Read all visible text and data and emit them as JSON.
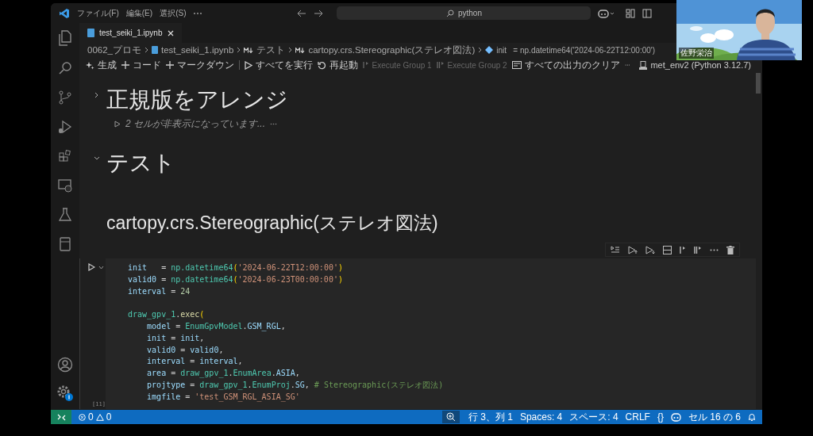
{
  "title_bar": {
    "menu": [
      "ファイル(F)",
      "編集(E)",
      "選択(S)"
    ],
    "search": {
      "value": "python"
    }
  },
  "tabs": [
    {
      "label": "test_seiki_1.ipynb",
      "selected": true
    }
  ],
  "breadcrumb": [
    {
      "label": "0062_プロモ",
      "kind": "folder"
    },
    {
      "label": "test_seiki_1.ipynb",
      "kind": "notebook"
    },
    {
      "label": "テスト",
      "kind": "markdown"
    },
    {
      "label": "cartopy.crs.Stereographic(ステレオ図法)",
      "kind": "markdown"
    },
    {
      "label": "init   = np.datetime64('2024-06-22T12:00:00')",
      "kind": "variable"
    }
  ],
  "toolbar": [
    {
      "label": "生成",
      "kind": "sparkle",
      "disabled": false
    },
    {
      "label": "コード",
      "kind": "plus",
      "disabled": false
    },
    {
      "label": "マークダウン",
      "kind": "plus",
      "disabled": false
    },
    {
      "label": "すべてを実行",
      "kind": "run",
      "disabled": false
    },
    {
      "label": "再起動",
      "kind": "restart",
      "disabled": false
    },
    {
      "label": "Execute Group 1",
      "kind": "group1",
      "disabled": true
    },
    {
      "label": "Execute Group 2",
      "kind": "group2",
      "disabled": true
    },
    {
      "label": "すべての出力のクリア",
      "kind": "clear",
      "disabled": false
    }
  ],
  "kernel": "met_env2 (Python 3.12.7)",
  "cells": [
    {
      "kind": "h1",
      "text": "正規版をアレンジ",
      "expanded": false,
      "hidden_note": "2 セルが非表示になっています..."
    },
    {
      "kind": "h1",
      "text": "テスト",
      "expanded": true
    },
    {
      "kind": "h2",
      "text": "cartopy.crs.Stereographic(ステレオ図法)"
    },
    {
      "kind": "code",
      "execution_count": "[11]",
      "lines": [
        {
          "kind": "code",
          "t": [
            {
              "text": "init",
              "kind": "var"
            },
            {
              "text": "   = ",
              "kind": "op"
            },
            {
              "text": "np.datetime64",
              "kind": "cls"
            },
            {
              "text": "(",
              "kind": "paren"
            },
            {
              "text": "'2024-06-22T12:00:00'",
              "kind": "str"
            },
            {
              "text": ")",
              "kind": "paren"
            }
          ]
        },
        {
          "kind": "code",
          "t": [
            {
              "text": "valid0",
              "kind": "var"
            },
            {
              "text": " = ",
              "kind": "op"
            },
            {
              "text": "np.datetime64",
              "kind": "cls"
            },
            {
              "text": "(",
              "kind": "paren"
            },
            {
              "text": "'2024-06-23T00:00:00'",
              "kind": "str"
            },
            {
              "text": ")",
              "kind": "paren"
            }
          ]
        },
        {
          "kind": "code",
          "t": [
            {
              "text": "interval",
              "kind": "var"
            },
            {
              "text": " = ",
              "kind": "op"
            },
            {
              "text": "24",
              "kind": "num"
            }
          ]
        },
        {
          "kind": "blank"
        },
        {
          "kind": "code",
          "t": [
            {
              "text": "draw_gpv_1",
              "kind": "cls"
            },
            {
              "text": ".",
              "kind": "op"
            },
            {
              "text": "exec",
              "kind": "fn"
            },
            {
              "text": "(",
              "kind": "paren"
            }
          ]
        },
        {
          "kind": "code",
          "t": [
            {
              "text": "    model",
              "kind": "var"
            },
            {
              "text": " = ",
              "kind": "op"
            },
            {
              "text": "EnumGpvModel",
              "kind": "cls"
            },
            {
              "text": ".",
              "kind": "op"
            },
            {
              "text": "GSM_RGL",
              "kind": "var"
            },
            {
              "text": ",",
              "kind": "op"
            }
          ]
        },
        {
          "kind": "code",
          "t": [
            {
              "text": "    init",
              "kind": "var"
            },
            {
              "text": " = ",
              "kind": "op"
            },
            {
              "text": "init",
              "kind": "var"
            },
            {
              "text": ",",
              "kind": "op"
            }
          ]
        },
        {
          "kind": "code",
          "t": [
            {
              "text": "    valid0",
              "kind": "var"
            },
            {
              "text": " = ",
              "kind": "op"
            },
            {
              "text": "valid0",
              "kind": "var"
            },
            {
              "text": ",",
              "kind": "op"
            }
          ]
        },
        {
          "kind": "code",
          "t": [
            {
              "text": "    interval",
              "kind": "var"
            },
            {
              "text": " = ",
              "kind": "op"
            },
            {
              "text": "interval",
              "kind": "var"
            },
            {
              "text": ",",
              "kind": "op"
            }
          ]
        },
        {
          "kind": "code",
          "t": [
            {
              "text": "    area",
              "kind": "var"
            },
            {
              "text": " = ",
              "kind": "op"
            },
            {
              "text": "draw_gpv_1",
              "kind": "cls"
            },
            {
              "text": ".",
              "kind": "op"
            },
            {
              "text": "EnumArea",
              "kind": "cls"
            },
            {
              "text": ".",
              "kind": "op"
            },
            {
              "text": "ASIA",
              "kind": "var"
            },
            {
              "text": ",",
              "kind": "op"
            }
          ]
        },
        {
          "kind": "code",
          "t": [
            {
              "text": "    projtype",
              "kind": "var"
            },
            {
              "text": " = ",
              "kind": "op"
            },
            {
              "text": "draw_gpv_1",
              "kind": "cls"
            },
            {
              "text": ".",
              "kind": "op"
            },
            {
              "text": "EnumProj",
              "kind": "cls"
            },
            {
              "text": ".",
              "kind": "op"
            },
            {
              "text": "SG",
              "kind": "var"
            },
            {
              "text": ", ",
              "kind": "op"
            },
            {
              "text": "# Stereographic(ステレオ図法)",
              "kind": "comment"
            }
          ]
        },
        {
          "kind": "code",
          "t": [
            {
              "text": "    imgfile",
              "kind": "var"
            },
            {
              "text": " = ",
              "kind": "op"
            },
            {
              "text": "'test_GSM_RGL_ASIA_SG'",
              "kind": "str"
            }
          ]
        }
      ]
    }
  ],
  "status_bar": {
    "errors": "0",
    "warnings": "0",
    "items": [
      {
        "kind": "text",
        "label": "行 3、列 1"
      },
      {
        "kind": "text",
        "label": "Spaces: 4"
      },
      {
        "kind": "text",
        "label": "スペース: 4"
      },
      {
        "kind": "text",
        "label": "CRLF"
      },
      {
        "kind": "text",
        "label": "{}"
      },
      {
        "kind": "copilot"
      },
      {
        "kind": "text",
        "label": "セル 16 の 6"
      },
      {
        "kind": "bell"
      }
    ]
  },
  "video_tile": {
    "name": "佐野栄治"
  }
}
